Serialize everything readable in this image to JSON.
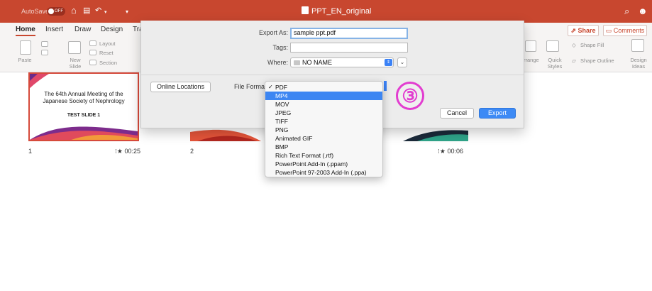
{
  "titlebar": {
    "autosave_label": "AutoSave",
    "autosave_state": "OFF",
    "title": "PPT_EN_original"
  },
  "ribbon": {
    "tabs": [
      {
        "label": "Home",
        "active": true
      },
      {
        "label": "Insert"
      },
      {
        "label": "Draw"
      },
      {
        "label": "Design"
      },
      {
        "label": "Tra"
      }
    ],
    "share_label": "Share",
    "comments_label": "Comments",
    "paste_label": "Paste",
    "new_slide_label": "New\nSlide",
    "layout_label": "Layout",
    "reset_label": "Reset",
    "section_label": "Section",
    "arrange_label": "rrange",
    "quick_styles_label": "Quick\nStyles",
    "shape_fill_label": "Shape Fill",
    "shape_outline_label": "Shape Outline",
    "design_ideas_label": "Design\nIdeas"
  },
  "slides": [
    {
      "number": "1",
      "title_line1": "The 64th Annual Meeting of the",
      "title_line2": "Japanese Society of Nephrology",
      "subtitle": "TEST SLIDE 1",
      "time": "00:25"
    },
    {
      "number": "2",
      "time": "00:06"
    }
  ],
  "export_dialog": {
    "export_as_label": "Export As:",
    "export_as_value": "sample ppt.pdf",
    "tags_label": "Tags:",
    "tags_value": "",
    "where_label": "Where:",
    "where_value": "NO NAME",
    "online_locations_label": "Online Locations",
    "file_format_label": "File Format",
    "cancel_label": "Cancel",
    "export_label": "Export"
  },
  "file_format_menu": {
    "checked": "PDF",
    "highlighted": "MP4",
    "options": [
      "PDF",
      "MP4",
      "MOV",
      "JPEG",
      "TIFF",
      "PNG",
      "Animated GIF",
      "BMP",
      "Rich Text Format (.rtf)",
      "PowerPoint Add-In (.ppam)",
      "PowerPoint 97-2003 Add-In (.ppa)"
    ]
  },
  "step_marker": "③",
  "colors": {
    "titlebar": "#c8472f",
    "accent_blue": "#3d86f2",
    "step_marker": "#e23dd0"
  }
}
